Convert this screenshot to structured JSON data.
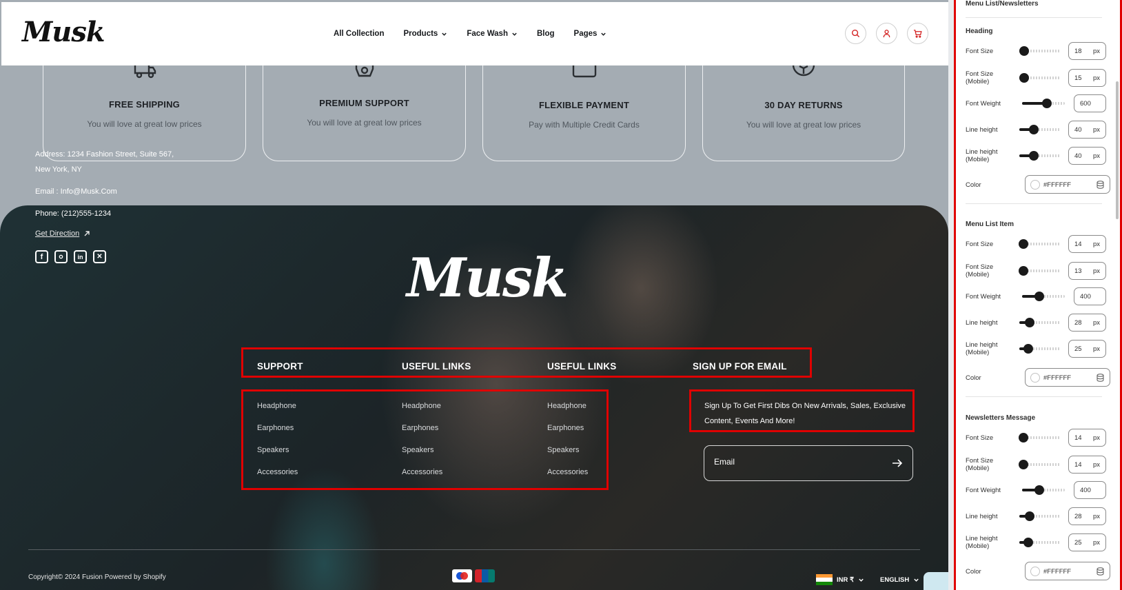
{
  "header": {
    "logo": "Musk",
    "nav": [
      {
        "label": "All Collection",
        "dropdown": false
      },
      {
        "label": "Products",
        "dropdown": true
      },
      {
        "label": "Face Wash",
        "dropdown": true
      },
      {
        "label": "Blog",
        "dropdown": false
      },
      {
        "label": "Pages",
        "dropdown": true
      }
    ],
    "icons": [
      "search-icon",
      "user-icon",
      "cart-icon"
    ],
    "accent_color": "#d32020"
  },
  "features": [
    {
      "title": "FREE SHIPPING",
      "desc": "You will love at great low prices",
      "icon": "truck-icon"
    },
    {
      "title": "PREMIUM SUPPORT",
      "desc": "You will love at great low prices",
      "icon": "support-icon"
    },
    {
      "title": "FLEXIBLE PAYMENT",
      "desc": "Pay with Multiple Credit Cards",
      "icon": "card-icon"
    },
    {
      "title": "30 DAY RETURNS",
      "desc": "You will love at great low prices",
      "icon": "return-box-icon"
    }
  ],
  "footer": {
    "logo": "Musk",
    "contact": {
      "address_line1": "Address: 1234 Fashion Street, Suite 567,",
      "address_line2": "New York, NY",
      "email": "Email : Info@Musk.Com",
      "phone": "Phone: (212)555-1234",
      "directions": "Get Direction"
    },
    "socials": [
      "facebook-icon",
      "instagram-icon",
      "linkedin-icon",
      "x-icon"
    ],
    "columns": [
      {
        "heading": "SUPPORT",
        "links": [
          "Headphone",
          "Earphones",
          "Speakers",
          "Accessories"
        ]
      },
      {
        "heading": "USEFUL LINKS",
        "links": [
          "Headphone",
          "Earphones",
          "Speakers",
          "Accessories"
        ]
      },
      {
        "heading": "USEFUL LINKS",
        "links": [
          "Headphone",
          "Earphones",
          "Speakers",
          "Accessories"
        ]
      }
    ],
    "newsletter": {
      "heading": "SIGN UP FOR EMAIL",
      "message_line1": "Sign Up To Get First Dibs On New Arrivals, Sales, Exclusive",
      "message_line2": "Content, Events And More!",
      "placeholder": "Email"
    },
    "copyright": "Copyright© 2024 Fusion Powered by Shopify",
    "payments": [
      "maestro",
      "unionpay"
    ],
    "currency": "INR ₹",
    "language": "ENGLISH",
    "highlight_color": "#e00000"
  },
  "panel": {
    "top_title": "Menu List/Newsletters",
    "sections": [
      {
        "title": "Heading",
        "rows": [
          {
            "label1": "Font Size",
            "label2": "",
            "value": "18",
            "unit": "px",
            "level": 0.12
          },
          {
            "label1": "Font Size",
            "label2": "(Mobile)",
            "value": "15",
            "unit": "px",
            "level": 0.12
          },
          {
            "label1": "Font Weight",
            "label2": "",
            "value": "600",
            "unit": "",
            "level": 0.58
          },
          {
            "label1": "Line height",
            "label2": "",
            "value": "40",
            "unit": "px",
            "level": 0.35
          },
          {
            "label1": "Line height",
            "label2": "(Mobile)",
            "value": "40",
            "unit": "px",
            "level": 0.35
          }
        ],
        "color": "#FFFFFF"
      },
      {
        "title": "Menu List Item",
        "rows": [
          {
            "label1": "Font Size",
            "label2": "",
            "value": "14",
            "unit": "px",
            "level": 0.1
          },
          {
            "label1": "Font Size",
            "label2": "(Mobile)",
            "value": "13",
            "unit": "px",
            "level": 0.1
          },
          {
            "label1": "Font Weight",
            "label2": "",
            "value": "400",
            "unit": "",
            "level": 0.4
          },
          {
            "label1": "Line height",
            "label2": "",
            "value": "28",
            "unit": "px",
            "level": 0.25
          },
          {
            "label1": "Line height",
            "label2": "(Mobile)",
            "value": "25",
            "unit": "px",
            "level": 0.22
          }
        ],
        "color": "#FFFFFF"
      },
      {
        "title": "Newsletters Message",
        "rows": [
          {
            "label1": "Font Size",
            "label2": "",
            "value": "14",
            "unit": "px",
            "level": 0.1
          },
          {
            "label1": "Font Size",
            "label2": "(Mobile)",
            "value": "14",
            "unit": "px",
            "level": 0.1
          },
          {
            "label1": "Font Weight",
            "label2": "",
            "value": "400",
            "unit": "",
            "level": 0.4
          },
          {
            "label1": "Line height",
            "label2": "",
            "value": "28",
            "unit": "px",
            "level": 0.25
          },
          {
            "label1": "Line height",
            "label2": "(Mobile)",
            "value": "25",
            "unit": "px",
            "level": 0.22
          }
        ],
        "color": "#FFFFFF"
      }
    ]
  }
}
